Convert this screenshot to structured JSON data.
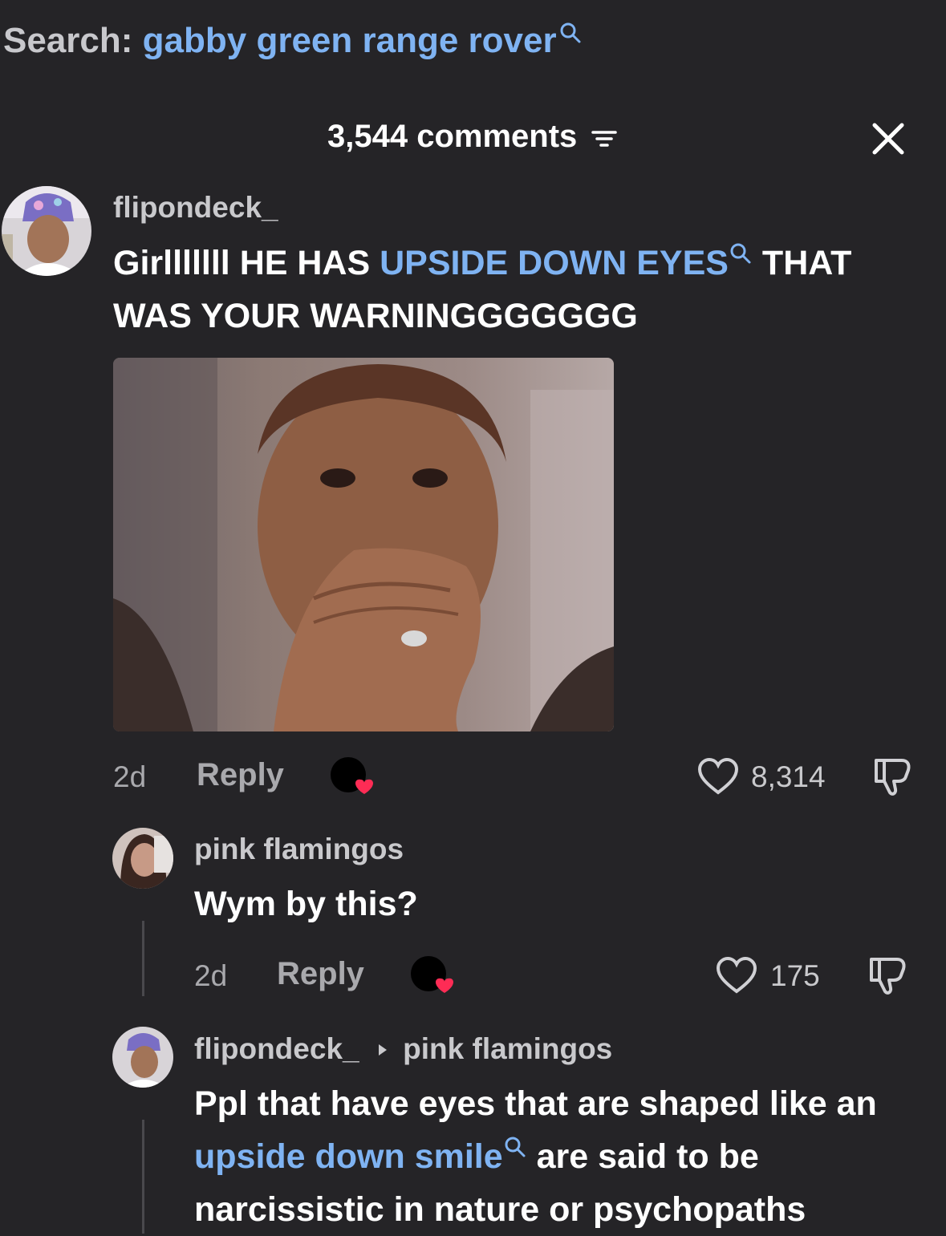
{
  "search": {
    "label": "Search:",
    "query": "gabby green range rover",
    "search_icon": "magnifier-icon"
  },
  "header": {
    "comment_count": "3,544 comments",
    "sort_icon": "filter-lines-icon",
    "close_icon": "close-icon"
  },
  "comments": [
    {
      "username": "flipondeck_",
      "text_before": "Girlllllll HE HAS ",
      "text_link": "UPSIDE DOWN EYES",
      "text_after": " THAT WAS YOUR WARNINGGGGGGG",
      "has_gif": true,
      "time": "2d",
      "reply_label": "Reply",
      "likes": "8,314"
    },
    {
      "username": "pink flamingos",
      "text": "Wym by this?",
      "time": "2d",
      "reply_label": "Reply",
      "likes": "175"
    },
    {
      "username": "flipondeck_",
      "reply_to": "pink flamingos",
      "text_before": "Ppl that have eyes that are shaped like an ",
      "text_link": "upside down smile",
      "text_after": " are said to be narcissistic in nature or psychopaths"
    }
  ],
  "colors": {
    "background": "#252427",
    "link": "#7fb3f2",
    "like_heart_badge": "#fe2c55"
  }
}
